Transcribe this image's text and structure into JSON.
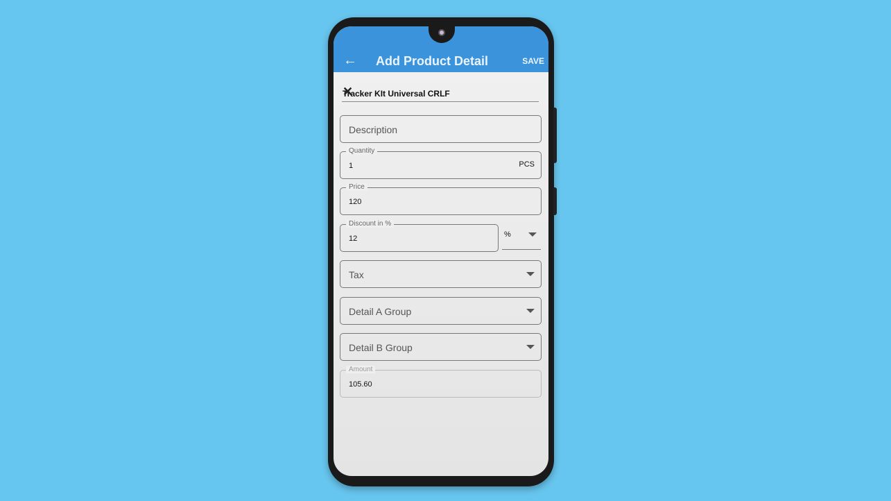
{
  "appbar": {
    "title": "Add Product Detail",
    "save_label": "SAVE",
    "back_icon": "arrow-left-icon"
  },
  "product": {
    "name": "Tracker KIt  Universal CRLF",
    "clear_icon": "close-icon"
  },
  "fields": {
    "description": {
      "placeholder": "Description"
    },
    "quantity": {
      "label": "Quantity",
      "value": "1",
      "unit": "PCS"
    },
    "price": {
      "label": "Price",
      "value": "120"
    },
    "discount": {
      "label": "Discount in %",
      "value": "12",
      "type_value": "%"
    },
    "tax": {
      "placeholder": "Tax"
    },
    "detail_a": {
      "placeholder": "Detail A Group"
    },
    "detail_b": {
      "placeholder": "Detail B Group"
    },
    "amount": {
      "label": "Amount",
      "value": "105.60"
    }
  },
  "colors": {
    "accent": "#3b93dc",
    "background": "#67c6ef"
  }
}
